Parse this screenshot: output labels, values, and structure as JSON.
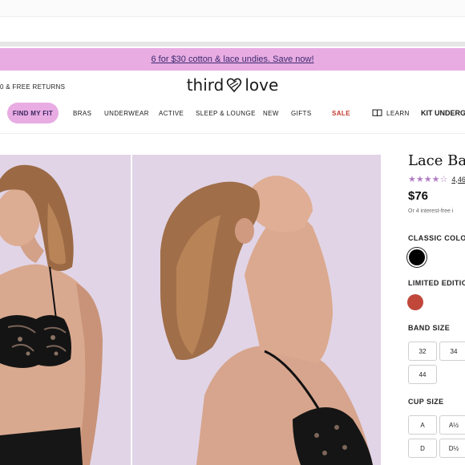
{
  "promo": {
    "text": "6 for $30 cotton & lace undies. Save now!"
  },
  "header": {
    "shipping_text": "0 & FREE RETURNS",
    "logo": {
      "part1": "third",
      "part2": "love"
    }
  },
  "nav": {
    "fit_button": "FIND MY FIT",
    "items": [
      "BRAS",
      "UNDERWEAR",
      "ACTIVE",
      "SLEEP & LOUNGE",
      "NEW",
      "GIFTS",
      "SALE"
    ],
    "learn": "LEARN",
    "kit": "KIT UNDERGARM"
  },
  "product": {
    "title": "Lace Ba",
    "stars": "★★★★☆",
    "rating_count": "4,46",
    "price": "$76",
    "installment": "Or 4 interest-free i",
    "classic_color_label": "CLASSIC COLOR",
    "limited_edition_label": "LIMITED EDITION",
    "band_size_label": "BAND SIZE",
    "band_sizes": [
      "32",
      "34",
      "44"
    ],
    "cup_size_label": "CUP SIZE",
    "cup_sizes": [
      "A",
      "A½",
      "D",
      "D½"
    ]
  },
  "colors": {
    "promo_bg": "#e8ace3",
    "star": "#b07ec4",
    "sale": "#c0392b",
    "swatch_classic": "#000000",
    "swatch_limited": "#c0473a",
    "photo_bg": "#e1d4e6"
  },
  "icons": {
    "logo_mark": "heart-outline-icon",
    "learn": "book-icon"
  }
}
